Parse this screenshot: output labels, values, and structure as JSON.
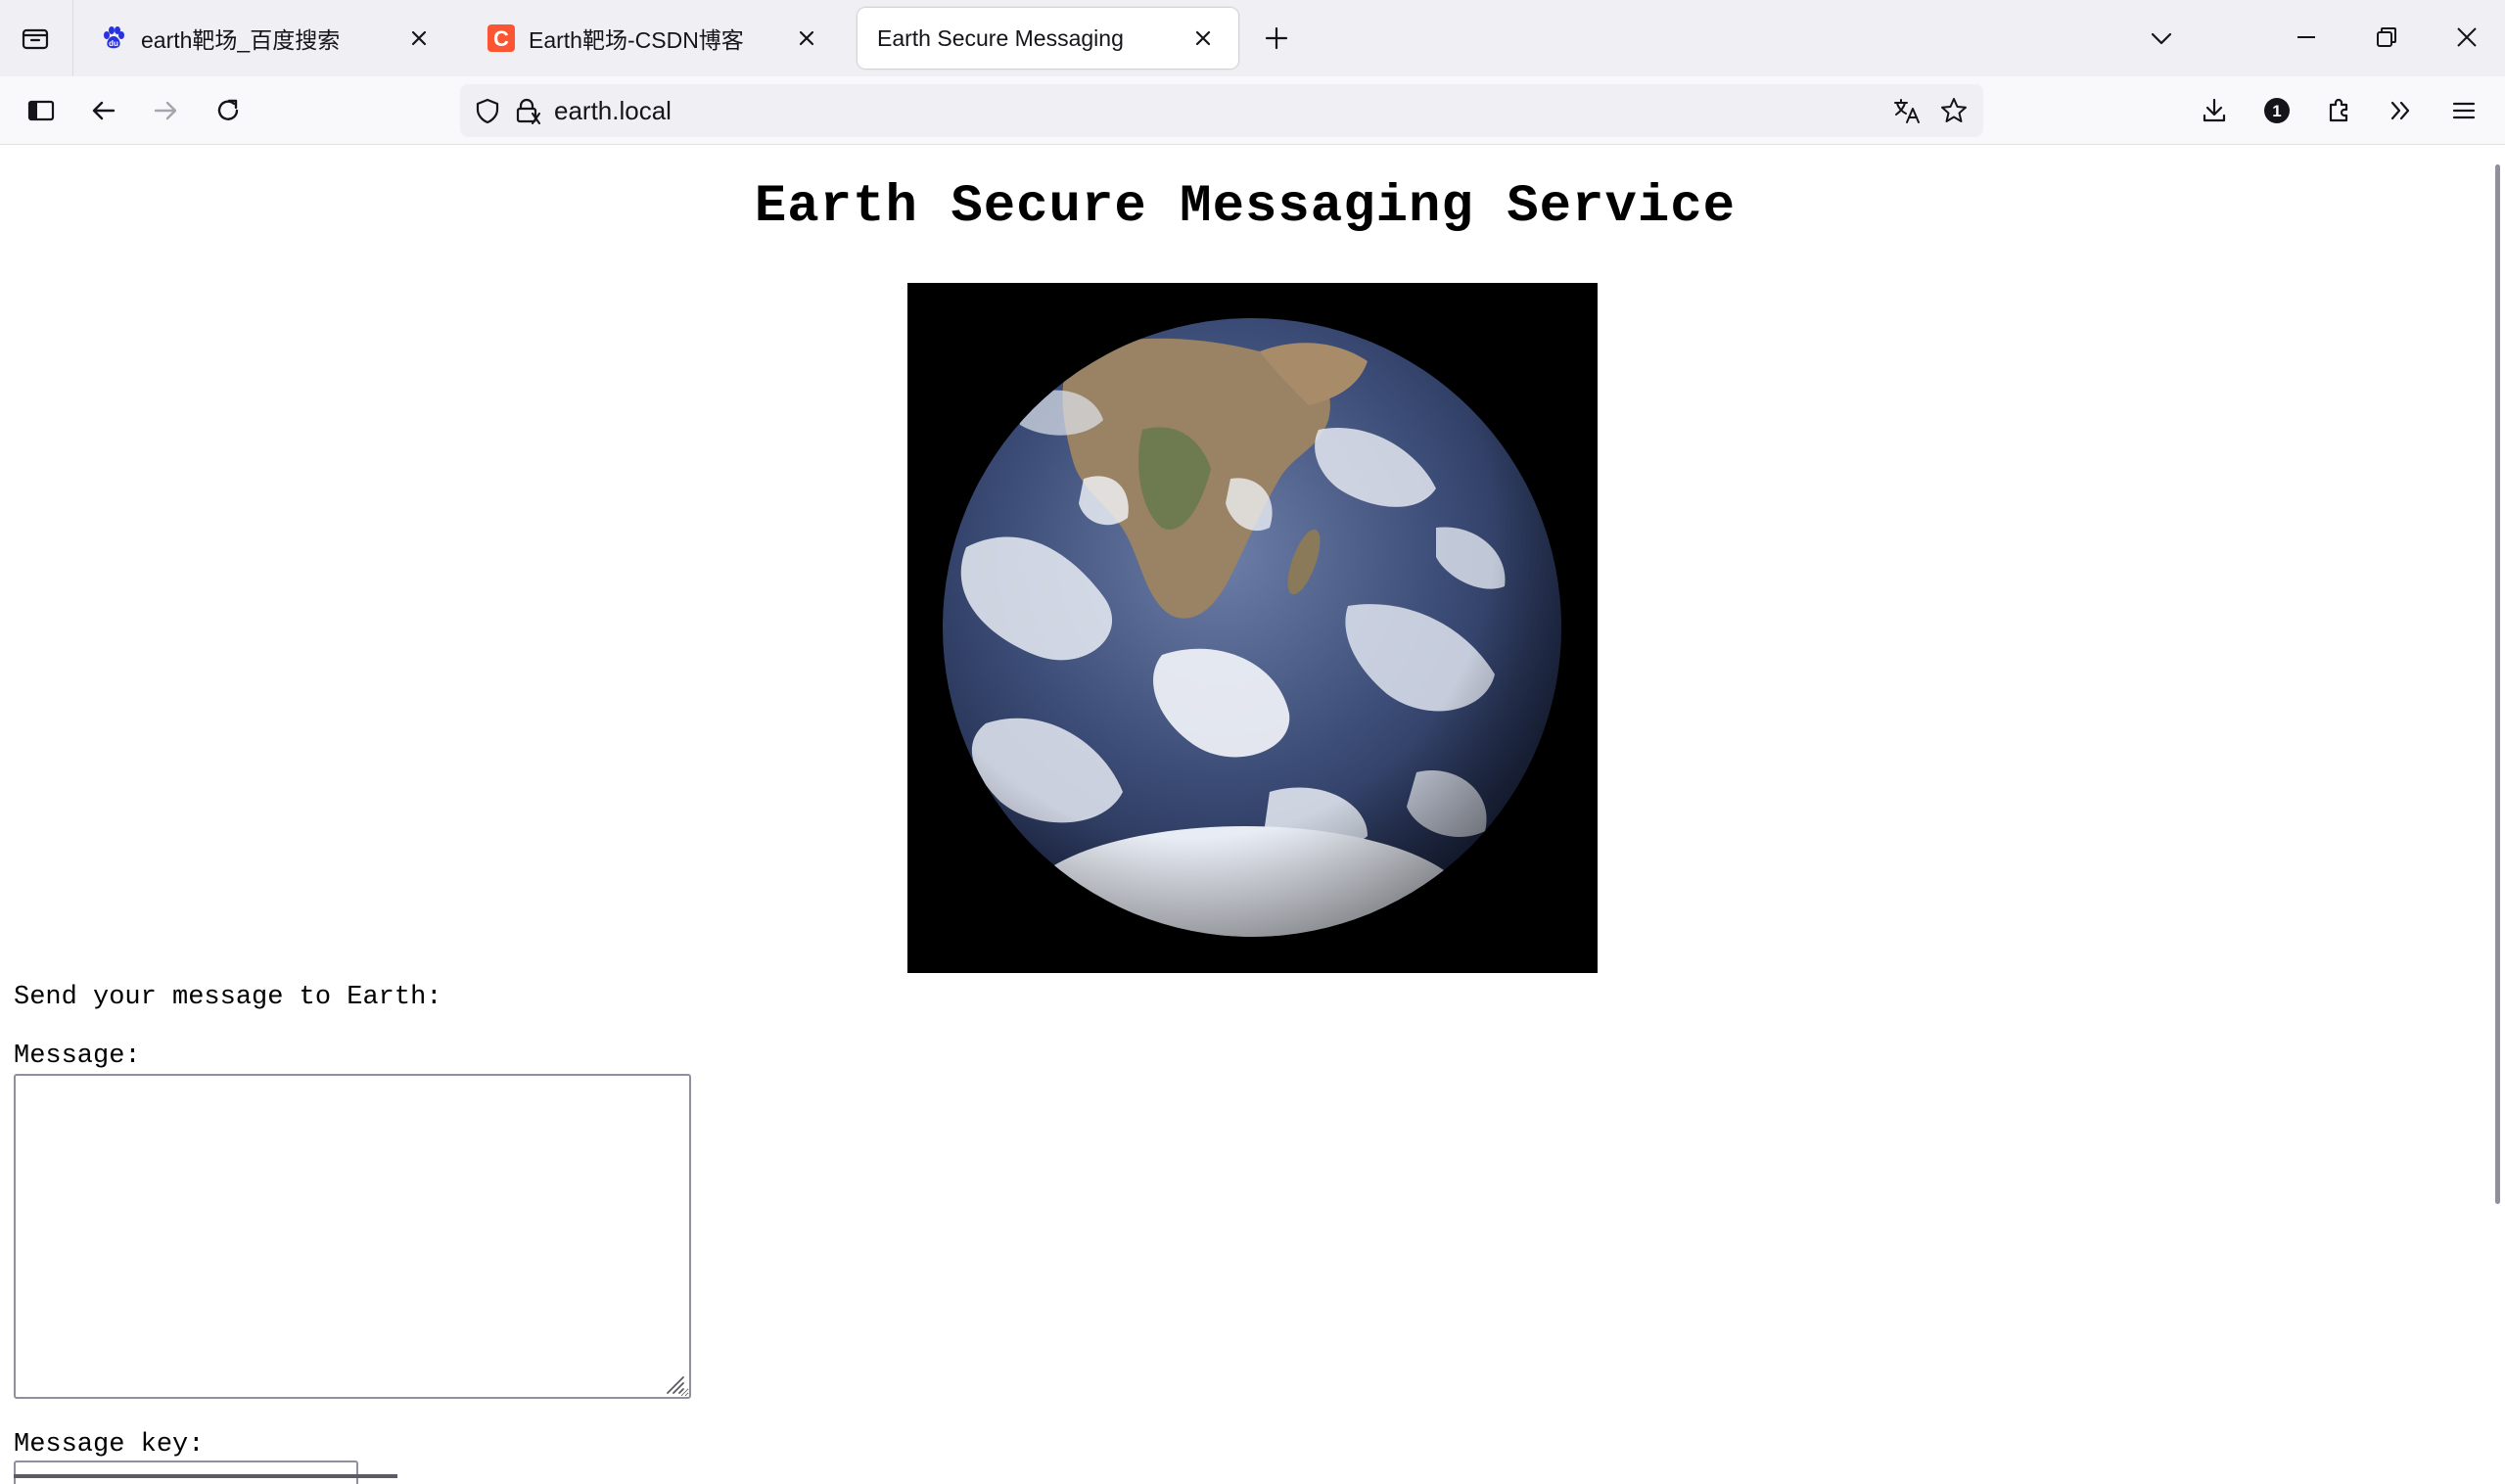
{
  "tabs": [
    {
      "title": "earth靶场_百度搜索",
      "favicon": "baidu-paw-icon",
      "active": false
    },
    {
      "title": "Earth靶场-CSDN博客",
      "favicon": "csdn-c-icon",
      "active": false
    },
    {
      "title": "Earth Secure Messaging",
      "favicon": "",
      "active": true
    }
  ],
  "colors": {
    "baidu_blue": "#2932e1",
    "csdn_red": "#fc5531",
    "tabstrip_bg": "#f0f0f4",
    "urlbar_bg": "#f0f0f4"
  },
  "urlbar": {
    "url": "earth.local"
  },
  "toolbar": {
    "icons": [
      "sidebar-icon",
      "back-icon",
      "forward-icon",
      "reload-icon",
      "download-icon",
      "password-manager-icon",
      "extensions-icon",
      "overflow-icon",
      "menu-icon"
    ],
    "password_badge": "1"
  },
  "page": {
    "title": "Earth Secure Messaging Service",
    "intro": "Send your message to Earth:",
    "message_label": "Message:",
    "message_value": "",
    "key_label": "Message key:",
    "key_value": ""
  }
}
